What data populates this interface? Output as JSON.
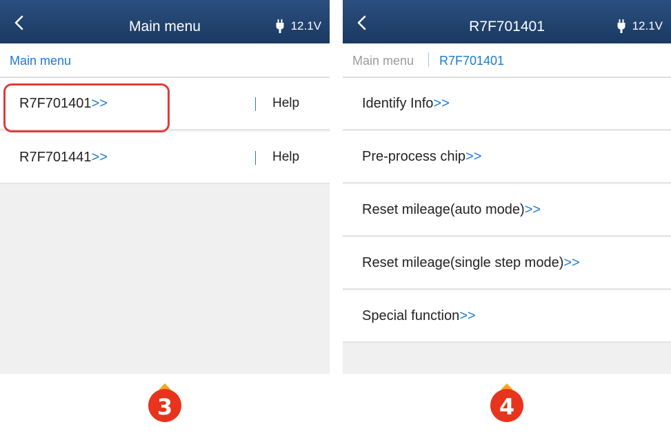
{
  "left_screen": {
    "header": {
      "title": "Main menu",
      "battery_icon": "plug-icon",
      "voltage": "12.1V"
    },
    "breadcrumb": {
      "items": [
        "Main menu"
      ]
    },
    "rows": [
      {
        "label": "R7F701401",
        "arrows": ">>",
        "help": "Help"
      },
      {
        "label": "R7F701441",
        "arrows": ">>",
        "help": "Help"
      }
    ]
  },
  "right_screen": {
    "header": {
      "title": "R7F701401",
      "battery_icon": "plug-icon",
      "voltage": "12.1V"
    },
    "breadcrumb": {
      "items": [
        "Main menu",
        "R7F701401"
      ]
    },
    "rows": [
      {
        "label": "Identify Info",
        "arrows": ">>"
      },
      {
        "label": "Pre-process chip",
        "arrows": ">>"
      },
      {
        "label": "Reset mileage(auto mode)",
        "arrows": ">>"
      },
      {
        "label": "Reset mileage(single step mode)",
        "arrows": ">>"
      },
      {
        "label": "Special function",
        "arrows": ">>"
      }
    ]
  },
  "step_badges": [
    "3",
    "4"
  ],
  "colors": {
    "header_bg": "#1f4370",
    "accent_blue": "#1a7ad4",
    "highlight_red": "#e23a3a",
    "badge_red": "#e8341c",
    "badge_top_orange": "#f5a623"
  }
}
